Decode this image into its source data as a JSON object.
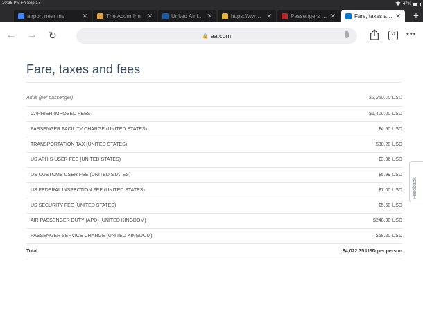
{
  "status_bar": {
    "time": "10:35 PM  Fri Sep 17",
    "battery": "47%"
  },
  "tabs": [
    {
      "title": "airport near me",
      "favicon": "google-g-icon",
      "color": "#4285f4",
      "active": false
    },
    {
      "title": "The Acorn Inn",
      "favicon": "acorn-inn-icon",
      "color": "#d9a441",
      "active": false
    },
    {
      "title": "United Airlines",
      "favicon": "united-globe-icon",
      "color": "#1a5aa8",
      "active": false
    },
    {
      "title": "https://www.gc",
      "favicon": "page-icon",
      "color": "#e2b33a",
      "active": false
    },
    {
      "title": "Passengers – F",
      "favicon": "aa-eagle-icon",
      "color": "#b5282f",
      "active": false
    },
    {
      "title": "Fare, taxes and",
      "favicon": "aa-eagle-icon",
      "color": "#0078d2",
      "active": true
    }
  ],
  "toolbar": {
    "url": "aa.com",
    "tab_count": "37"
  },
  "page": {
    "title": "Fare, taxes and fees",
    "rows": [
      {
        "label": "Adult (per passenger)",
        "amount": "$2,250.00 USD",
        "kind": "header"
      },
      {
        "label": "CARRIER-IMPOSED FEES",
        "amount": "$1,400.00 USD",
        "kind": "fee"
      },
      {
        "label": "PASSENGER FACILITY CHARGE (UNITED STATES)",
        "amount": "$4.50 USD",
        "kind": "fee"
      },
      {
        "label": "TRANSPORTATION TAX (UNITED STATES)",
        "amount": "$38.20 USD",
        "kind": "fee"
      },
      {
        "label": "US APHIS USER FEE (UNITED STATES)",
        "amount": "$3.96 USD",
        "kind": "fee"
      },
      {
        "label": "US CUSTOMS USER FEE (UNITED STATES)",
        "amount": "$5.99 USD",
        "kind": "fee"
      },
      {
        "label": "US FEDERAL INSPECTION FEE (UNITED STATES)",
        "amount": "$7.00 USD",
        "kind": "fee"
      },
      {
        "label": "US SECURITY FEE (UNITED STATES)",
        "amount": "$5.60 USD",
        "kind": "fee"
      },
      {
        "label": "AIR PASSENGER DUTY (APD) (UNITED KINGDOM)",
        "amount": "$248.90 USD",
        "kind": "fee"
      },
      {
        "label": "PASSENGER SERVICE CHARGE (UNITED KINGDOM)",
        "amount": "$58.20 USD",
        "kind": "fee"
      },
      {
        "label": "Total",
        "amount": "$4,022.35 USD per person",
        "kind": "total"
      }
    ],
    "feedback_label": "Feedback"
  }
}
